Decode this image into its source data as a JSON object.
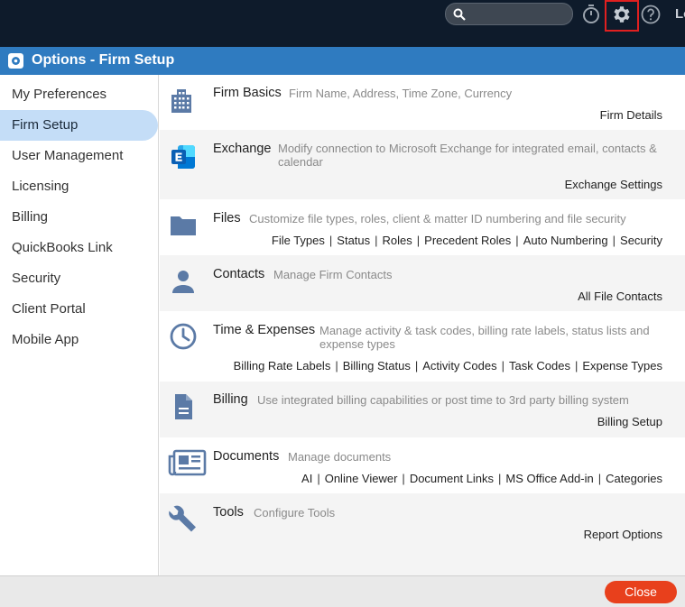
{
  "topbar": {
    "search_placeholder": "",
    "user_text_partial": "Lo"
  },
  "dialog": {
    "title": "Options - Firm Setup"
  },
  "sidebar": {
    "items": [
      {
        "label": "My Preferences"
      },
      {
        "label": "Firm Setup",
        "active": true
      },
      {
        "label": "User Management"
      },
      {
        "label": "Licensing"
      },
      {
        "label": "Billing"
      },
      {
        "label": "QuickBooks Link"
      },
      {
        "label": "Security"
      },
      {
        "label": "Client Portal"
      },
      {
        "label": "Mobile App"
      }
    ]
  },
  "sections": [
    {
      "title": "Firm Basics",
      "desc": "Firm Name, Address, Time Zone, Currency",
      "icon": "building-icon",
      "links": [
        "Firm Details"
      ]
    },
    {
      "title": "Exchange",
      "desc": "Modify connection to Microsoft Exchange for integrated email, contacts & calendar",
      "icon": "exchange-icon",
      "links": [
        "Exchange Settings"
      ]
    },
    {
      "title": "Files",
      "desc": "Customize file types, roles, client & matter ID numbering and file security",
      "icon": "folder-icon",
      "links": [
        "File Types",
        "Status",
        "Roles",
        "Precedent Roles",
        "Auto Numbering",
        "Security"
      ]
    },
    {
      "title": "Contacts",
      "desc": "Manage Firm Contacts",
      "icon": "person-icon",
      "links": [
        "All File Contacts"
      ]
    },
    {
      "title": "Time & Expenses",
      "desc": "Manage activity & task codes, billing rate labels, status lists and expense types",
      "icon": "clock-icon",
      "links": [
        "Billing Rate Labels",
        "Billing Status",
        "Activity Codes",
        "Task Codes",
        "Expense Types"
      ]
    },
    {
      "title": "Billing",
      "desc": "Use integrated billing capabilities or post time to 3rd party billing system",
      "icon": "document-icon",
      "links": [
        "Billing Setup"
      ]
    },
    {
      "title": "Documents",
      "desc": "Manage documents",
      "icon": "newspaper-icon",
      "links": [
        "AI",
        "Online Viewer",
        "Document Links",
        "MS Office Add-in",
        "Categories"
      ]
    },
    {
      "title": "Tools",
      "desc": "Configure Tools",
      "icon": "wrench-icon",
      "links": [
        "Report Options"
      ]
    }
  ],
  "footer": {
    "close_label": "Close"
  },
  "colors": {
    "accent": "#2f7bc0",
    "icon": "#5b7aa6",
    "close": "#e8401c",
    "active_nav": "#c4ddf7"
  }
}
